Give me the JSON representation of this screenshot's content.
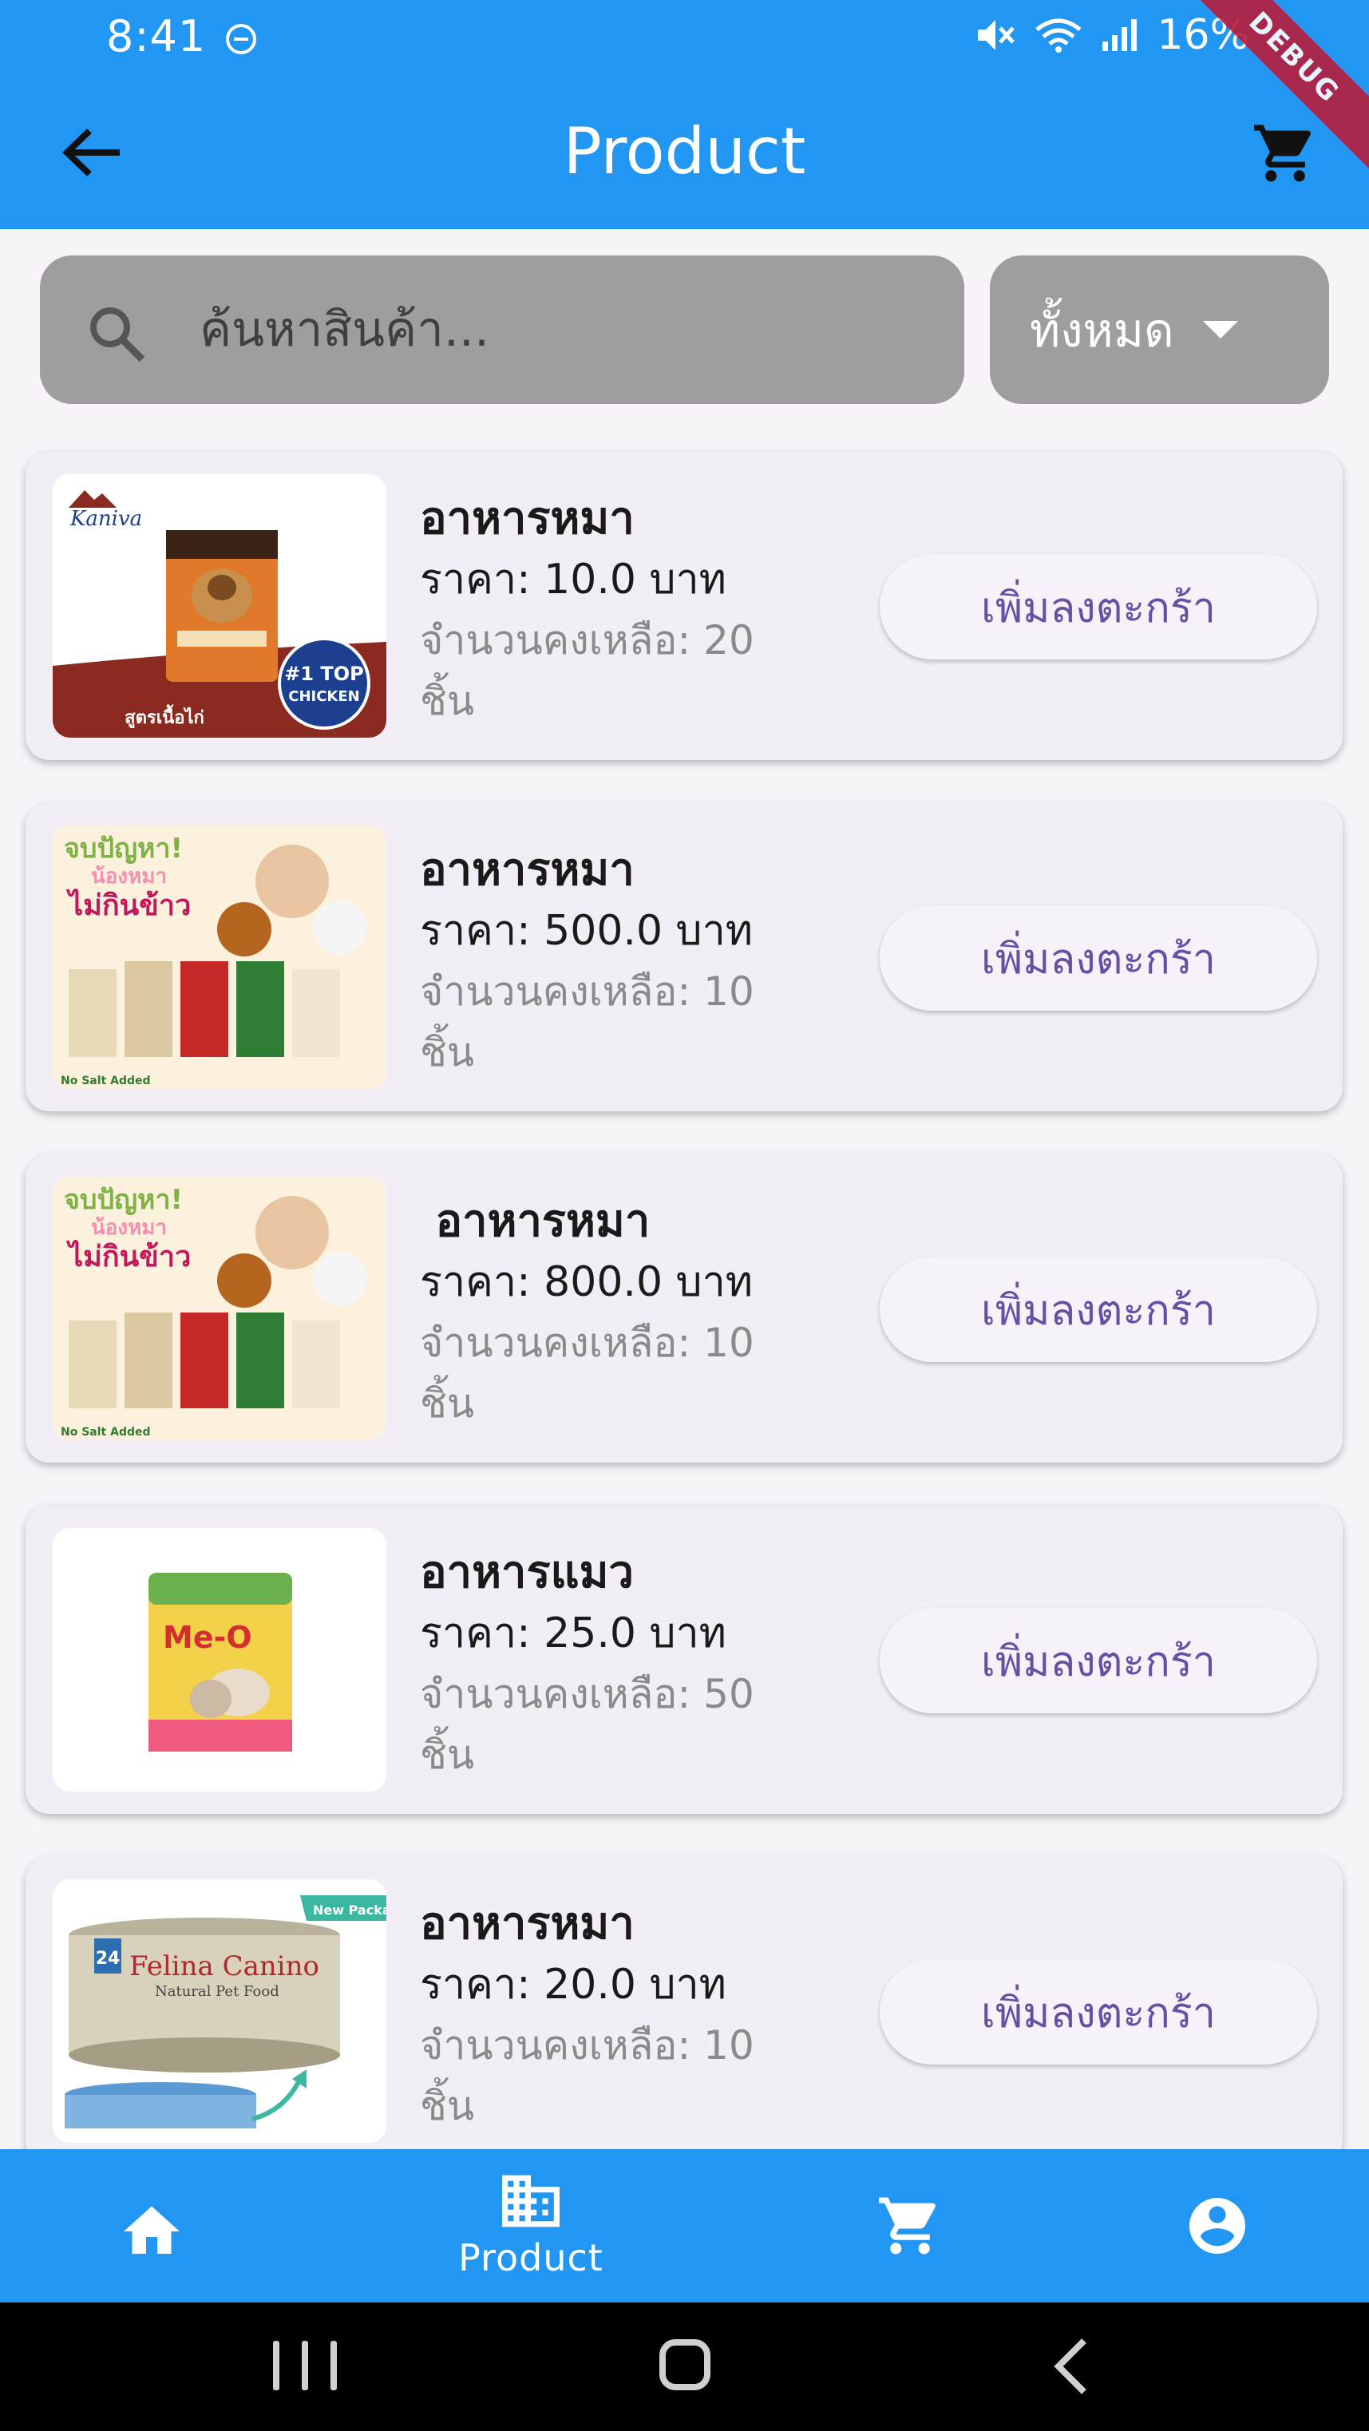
{
  "status_bar": {
    "time": "8:41",
    "battery": "16%",
    "debug_banner": "DEBUG"
  },
  "app_bar": {
    "title": "Product",
    "back_icon": "arrow-back-icon",
    "cart_icon": "shopping-cart-icon"
  },
  "search": {
    "placeholder": "ค้นหาสินค้า...",
    "value": ""
  },
  "filter": {
    "selected": "ทั้งหมด"
  },
  "products": [
    {
      "name": "อาหารหมา",
      "price": "ราคา: 10.0 บาท",
      "stock_line1": "จำนวนคงเหลือ: 20",
      "stock_line2": "ชิ้น",
      "button": "เพิ่มลงตะกร้า"
    },
    {
      "name": "อาหารหมา",
      "price": "ราคา: 500.0 บาท",
      "stock_line1": "จำนวนคงเหลือ: 10",
      "stock_line2": "ชิ้น",
      "button": "เพิ่มลงตะกร้า"
    },
    {
      "name": " อาหารหมา",
      "price": "ราคา: 800.0 บาท",
      "stock_line1": "จำนวนคงเหลือ: 10",
      "stock_line2": "ชิ้น",
      "button": "เพิ่มลงตะกร้า"
    },
    {
      "name": "อาหารแมว",
      "price": "ราคา: 25.0 บาท",
      "stock_line1": "จำนวนคงเหลือ: 50",
      "stock_line2": "ชิ้น",
      "button": "เพิ่มลงตะกร้า"
    },
    {
      "name": "อาหารหมา",
      "price": "ราคา: 20.0 บาท",
      "stock_line1": "จำนวนคงเหลือ: 10",
      "stock_line2": "ชิ้น",
      "button": "เพิ่มลงตะกร้า"
    }
  ],
  "product_image_text": {
    "kaniva_brand": "Kaniva",
    "kaniva_badge_top": "#1 TOP",
    "kaniva_badge_bottom": "CHICKEN",
    "kaniva_footer": "สูตรเนื้อไก่",
    "promo_line1": "จบปัญหา!",
    "promo_line2": "น้องหมา",
    "promo_line3": "ไม่กินข้าว",
    "promo_footer": "No Salt Added",
    "meo_brand": "Me-O",
    "felina_badge": "New Package",
    "felina_brand": "Felina Canino",
    "felina_sub": "Natural Pet Food",
    "felina_number": "24"
  },
  "bottom_nav": {
    "items": [
      {
        "icon": "home-icon",
        "label": ""
      },
      {
        "icon": "business-icon",
        "label": "Product"
      },
      {
        "icon": "shopping-cart-icon",
        "label": ""
      },
      {
        "icon": "account-circle-icon",
        "label": ""
      }
    ]
  },
  "colors": {
    "primary": "#2196f3",
    "button_text": "#6750a4",
    "card_bg": "#f3eef6",
    "search_bg": "#9e9e9e"
  }
}
